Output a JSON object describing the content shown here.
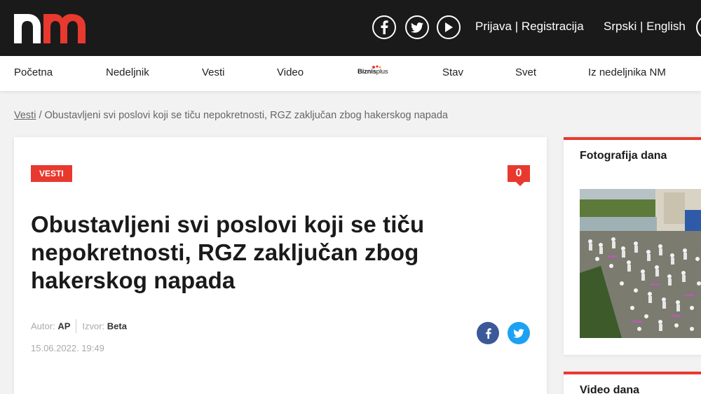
{
  "header": {
    "logo_alt": "nm",
    "social": [
      "facebook-icon",
      "twitter-icon",
      "youtube-icon"
    ],
    "login": "Prijava",
    "auth_sep": " | ",
    "register": "Registracija",
    "lang_sr": "Srpski",
    "lang_sep": " | ",
    "lang_en": "English"
  },
  "nav": {
    "items": [
      "Početna",
      "Nedeljnik",
      "Vesti",
      "Video",
      "Stav",
      "Svet",
      "Iz nedeljnika NM"
    ],
    "biznis_bold": "Biznis",
    "biznis_plus": "plus"
  },
  "breadcrumb": {
    "link": "Vesti",
    "sep": " / ",
    "current": "Obustavljeni svi poslovi koji se tiču nepokretnosti, RGZ zaključan zbog hakerskog napada"
  },
  "article": {
    "category": "VESTI",
    "comment_count": "0",
    "title": "Obustavljeni svi poslovi koji se tiču nepokretnosti, RGZ zaključan zbog hakerskog napada",
    "author_label": "Autor:",
    "author": "AP",
    "source_label": "Izvor:",
    "source": "Beta",
    "date": "15.06.2022. 19:49"
  },
  "sidebar": {
    "photo_title": "Fotografija dana",
    "video_title": "Video dana"
  },
  "colors": {
    "accent": "#e8392f",
    "topbar": "#1a1a1a",
    "facebook": "#3b5998",
    "twitter": "#1da1f2"
  }
}
